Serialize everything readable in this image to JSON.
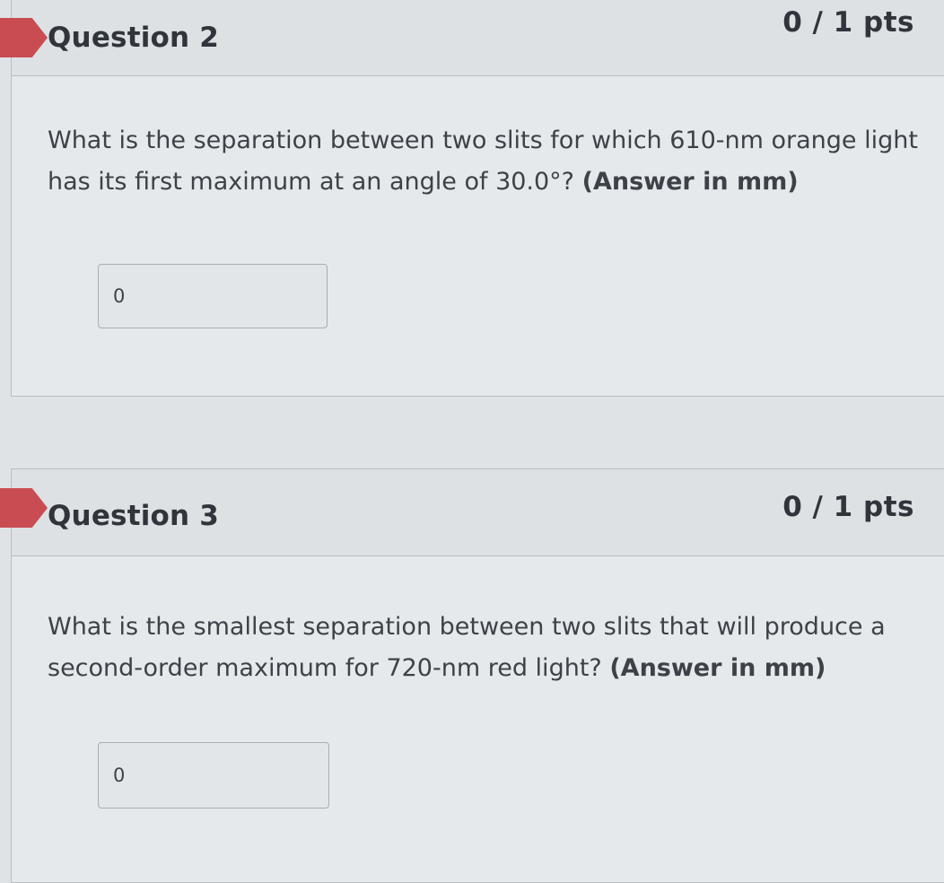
{
  "questions": [
    {
      "title": "Question 2",
      "points": "0 / 1 pts",
      "text": "What is the separation between two slits for which 610-nm orange light has its first maximum at an angle of 30.0°? ",
      "answer_hint": "(Answer in mm)",
      "answer_value": "0"
    },
    {
      "title": "Question 3",
      "points": "0 / 1 pts",
      "text": "What is the smallest separation between two slits that will produce a second-order maximum for 720-nm red light? ",
      "answer_hint": "(Answer in mm)",
      "answer_value": "0"
    }
  ],
  "colors": {
    "flag": "#c84c52",
    "background": "#e6e9ec",
    "header": "#dde1e4"
  }
}
